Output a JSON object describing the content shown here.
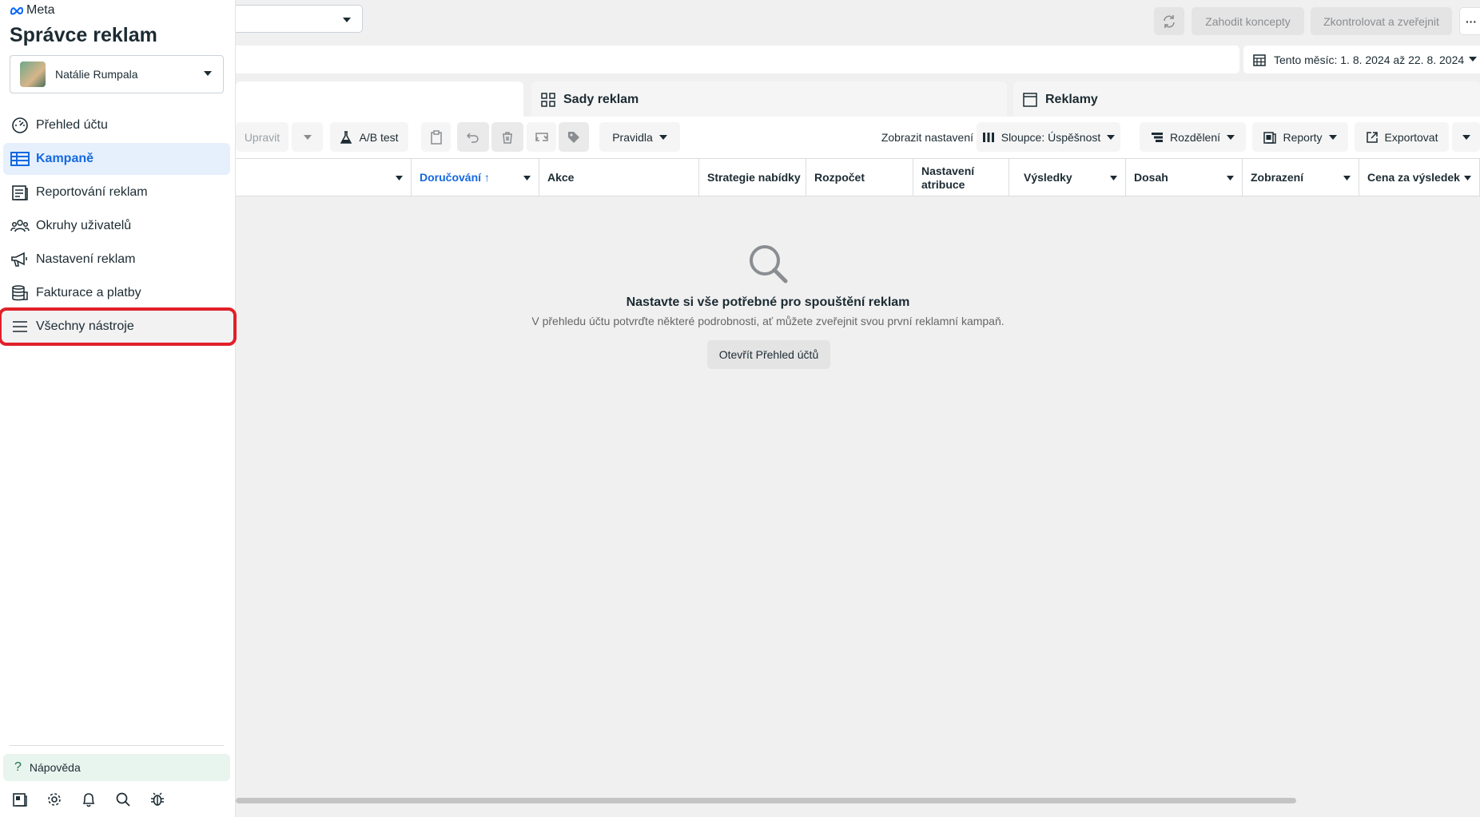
{
  "sidebar": {
    "logo_text": "Meta",
    "title": "Správce reklam",
    "account": {
      "name": "Natálie Rumpala"
    },
    "items": [
      {
        "label": "Přehled účtu",
        "icon": "gauge-icon"
      },
      {
        "label": "Kampaně",
        "icon": "table-grid-icon"
      },
      {
        "label": "Reportování reklam",
        "icon": "report-icon"
      },
      {
        "label": "Okruhy uživatelů",
        "icon": "people-icon"
      },
      {
        "label": "Nastavení reklam",
        "icon": "megaphone-icon"
      },
      {
        "label": "Fakturace a platby",
        "icon": "coins-icon"
      },
      {
        "label": "Všechny nástroje",
        "icon": "menu-icon"
      }
    ],
    "help_label": "Nápověda",
    "bottom_icons": [
      "pages-icon",
      "gear-icon",
      "bell-icon",
      "search-icon",
      "bug-icon"
    ]
  },
  "topbar": {
    "discard_label": "Zahodit koncepty",
    "review_label": "Zkontrolovat a zveřejnit",
    "more_label": "···",
    "date_range": "Tento měsíc: 1. 8. 2024 až 22. 8. 2024"
  },
  "tabs": [
    {
      "label": ""
    },
    {
      "label": "Sady reklam"
    },
    {
      "label": "Reklamy"
    }
  ],
  "toolbar": {
    "edit_label": "Upravit",
    "ab_test_label": "A/B test",
    "rules_label": "Pravidla",
    "show_settings_label": "Zobrazit nastavení",
    "columns_label": "Sloupce: Úspěšnost",
    "breakdown_label": "Rozdělení",
    "reports_label": "Reporty",
    "export_label": "Exportovat"
  },
  "table": {
    "columns": [
      "",
      "Doručování ↑",
      "Akce",
      "Strategie nabídky",
      "Rozpočet",
      "Nastavení atribuce",
      "Výsledky",
      "Dosah",
      "Zobrazení",
      "Cena za výsledek"
    ]
  },
  "empty_state": {
    "title": "Nastavte si vše potřebné pro spouštění reklam",
    "subtitle": "V přehledu účtu potvrďte některé podrobnosti, ať můžete zveřejnit svou první reklamní kampaň.",
    "button_label": "Otevřít Přehled účtů"
  },
  "colors": {
    "accent": "#1469e0",
    "highlight_box": "#e0202a",
    "active_bg": "#e6f0fd"
  }
}
